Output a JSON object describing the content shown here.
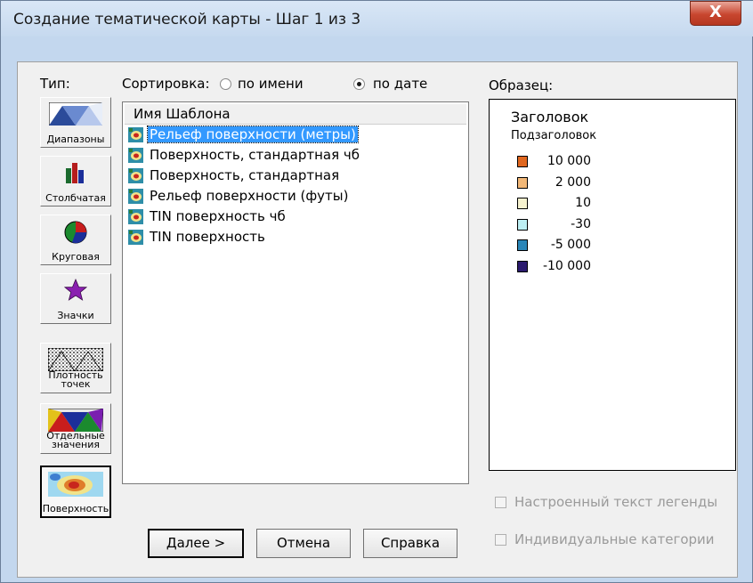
{
  "window": {
    "title": "Создание тематической карты - Шаг 1 из 3",
    "close_glyph": "X"
  },
  "type_panel": {
    "label": "Тип:",
    "buttons": [
      {
        "id": "ranges",
        "label": "Диапазоны",
        "icon": "ranges-icon"
      },
      {
        "id": "bar",
        "label": "Столбчатая",
        "icon": "bar-chart-icon"
      },
      {
        "id": "pie",
        "label": "Круговая",
        "icon": "pie-chart-icon"
      },
      {
        "id": "symbols",
        "label": "Значки",
        "icon": "star-icon"
      },
      {
        "id": "density",
        "label": "Плотность точек",
        "icon": "dot-density-icon"
      },
      {
        "id": "individual",
        "label": "Отдельные значения",
        "icon": "individual-values-icon"
      },
      {
        "id": "surface",
        "label": "Поверхность",
        "icon": "surface-icon",
        "active": true
      }
    ]
  },
  "sort": {
    "label": "Сортировка:",
    "by_name": "по имени",
    "by_date": "по дате",
    "selected": "by_date"
  },
  "template_list": {
    "header": "Имя Шаблона",
    "items": [
      {
        "label": "Рельеф поверхности (метры)",
        "selected": true
      },
      {
        "label": "Поверхность, стандартная чб"
      },
      {
        "label": "Поверхность, стандартная"
      },
      {
        "label": "Рельеф поверхности (футы)"
      },
      {
        "label": "TIN поверхность чб"
      },
      {
        "label": "TIN поверхность"
      }
    ]
  },
  "sample": {
    "label": "Образец:",
    "title": "Заголовок",
    "subtitle": "Подзаголовок",
    "legend": [
      {
        "value": "10 000",
        "color": "#e0671f"
      },
      {
        "value": "2 000",
        "color": "#f2b878"
      },
      {
        "value": "10",
        "color": "#f6f2cf"
      },
      {
        "value": "-30",
        "color": "#bdeff3"
      },
      {
        "value": "-5 000",
        "color": "#2a86b8"
      },
      {
        "value": "-10 000",
        "color": "#2b1a6e"
      }
    ]
  },
  "options": {
    "custom_legend_text": "Настроенный текст легенды",
    "individual_categories": "Индивидуальные категории"
  },
  "buttons": {
    "next": "Далее >",
    "cancel": "Отмена",
    "help": "Справка"
  }
}
